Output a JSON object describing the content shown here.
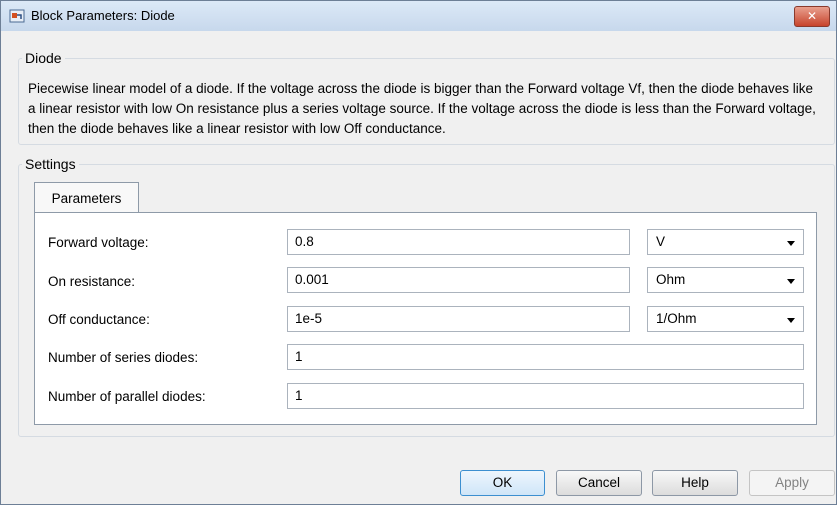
{
  "window": {
    "title": "Block Parameters: Diode",
    "close_label": "✕"
  },
  "diode_group": {
    "label": "Diode",
    "description": "Piecewise linear model of a diode. If the voltage across the diode is bigger than the Forward voltage Vf, then the diode behaves like a linear resistor with low On resistance plus a series voltage source. If the voltage across the diode is less than the Forward voltage, then the diode behaves like a linear resistor with low Off conductance."
  },
  "settings": {
    "label": "Settings",
    "tab_label": "Parameters",
    "rows": [
      {
        "label": "Forward voltage:",
        "value": "0.8",
        "unit": "V"
      },
      {
        "label": "On resistance:",
        "value": "0.001",
        "unit": "Ohm"
      },
      {
        "label": "Off conductance:",
        "value": "1e-5",
        "unit": "1/Ohm"
      },
      {
        "label": "Number of series diodes:",
        "value": "1"
      },
      {
        "label": "Number of parallel diodes:",
        "value": "1"
      }
    ]
  },
  "buttons": {
    "ok": "OK",
    "cancel": "Cancel",
    "help": "Help",
    "apply": "Apply"
  }
}
